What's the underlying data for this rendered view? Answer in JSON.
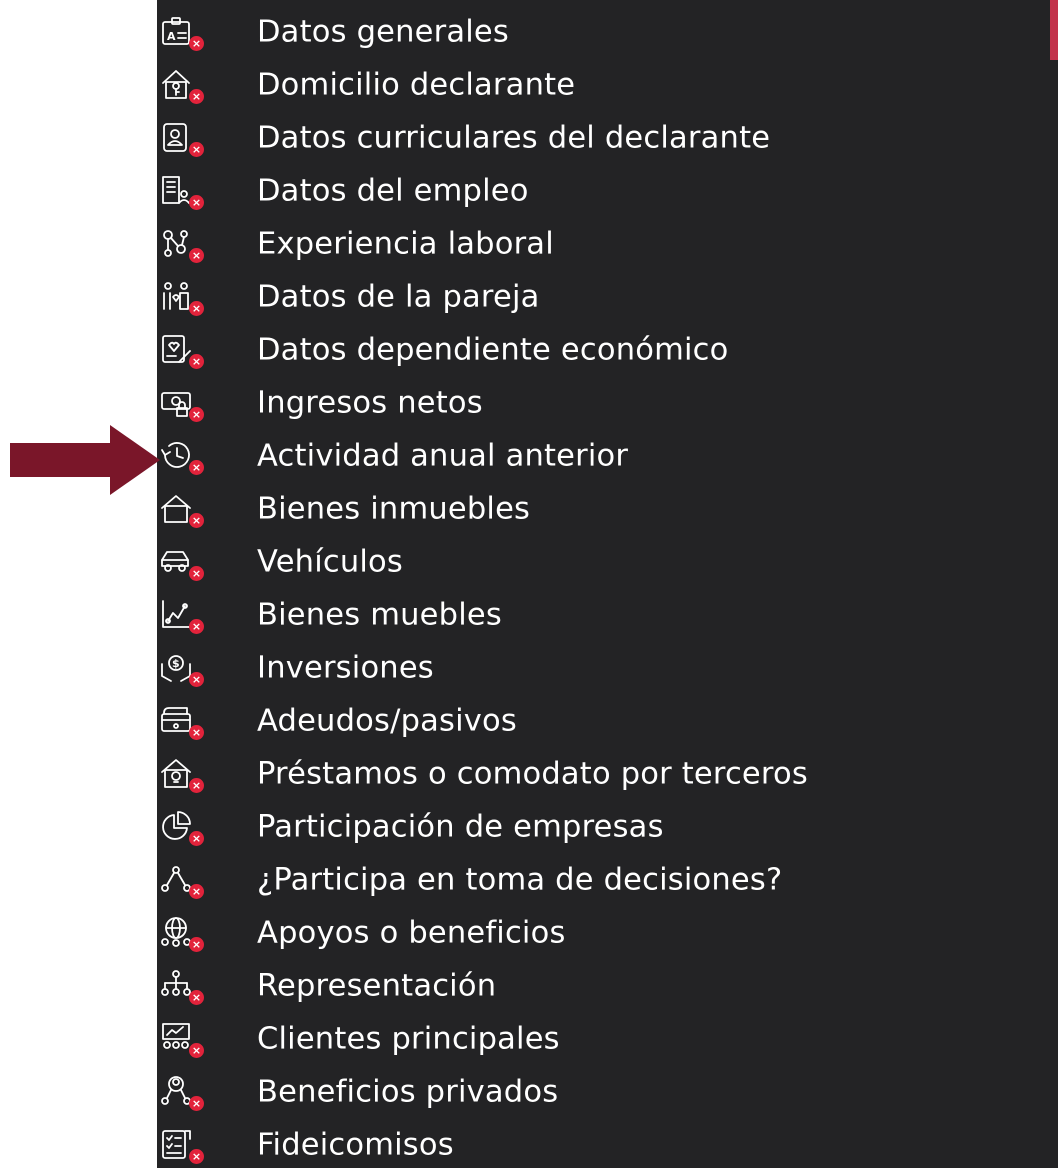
{
  "colors": {
    "panel_background": "#232325",
    "text": "#ffffff",
    "status_badge": "#e2233b",
    "pointer_arrow": "#7a1629",
    "accent_bar": "#c2334b"
  },
  "status_badge_symbol": "×",
  "menu": {
    "items": [
      {
        "label": "Datos generales",
        "icon": "id-card-icon"
      },
      {
        "label": "Domicilio declarante",
        "icon": "house-key-icon"
      },
      {
        "label": "Datos curriculares del declarante",
        "icon": "resume-icon"
      },
      {
        "label": "Datos del empleo",
        "icon": "building-person-icon"
      },
      {
        "label": "Experiencia laboral",
        "icon": "people-network-icon"
      },
      {
        "label": "Datos de la pareja",
        "icon": "couple-icon"
      },
      {
        "label": "Datos dependiente económico",
        "icon": "document-heart-icon"
      },
      {
        "label": "Ingresos netos",
        "icon": "money-lock-icon"
      },
      {
        "label": "Actividad anual anterior",
        "icon": "history-clock-icon"
      },
      {
        "label": "Bienes inmuebles",
        "icon": "house-icon"
      },
      {
        "label": "Vehículos",
        "icon": "car-icon"
      },
      {
        "label": "Bienes muebles",
        "icon": "trend-chart-icon"
      },
      {
        "label": "Inversiones",
        "icon": "hand-money-icon"
      },
      {
        "label": "Adeudos/pasivos",
        "icon": "debt-card-icon"
      },
      {
        "label": "Préstamos o comodato por terceros",
        "icon": "house-lightbulb-icon"
      },
      {
        "label": "Participación de empresas",
        "icon": "pie-chart-icon"
      },
      {
        "label": "¿Participa en toma de decisiones?",
        "icon": "org-nodes-icon"
      },
      {
        "label": "Apoyos o beneficios",
        "icon": "globe-people-icon"
      },
      {
        "label": "Representación",
        "icon": "hierarchy-people-icon"
      },
      {
        "label": "Clientes principales",
        "icon": "presentation-people-icon"
      },
      {
        "label": "Beneficios privados",
        "icon": "user-network-icon"
      },
      {
        "label": "Fideicomisos",
        "icon": "checklist-icon"
      }
    ]
  }
}
